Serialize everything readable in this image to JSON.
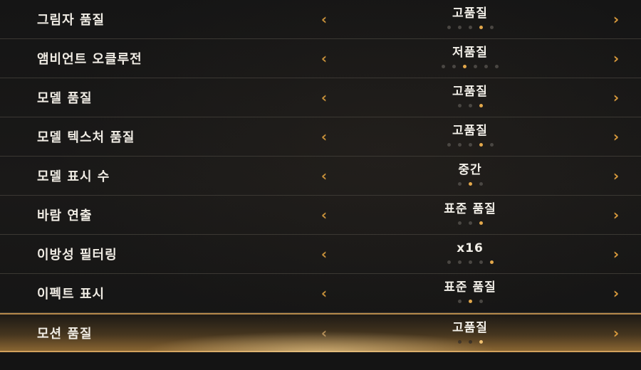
{
  "settings": [
    {
      "label": "그림자 품질",
      "value": "고품질",
      "levels": 5,
      "active": 3
    },
    {
      "label": "앰비언트 오클루전",
      "value": "저품질",
      "levels": 6,
      "active": 2
    },
    {
      "label": "모델 품질",
      "value": "고품질",
      "levels": 3,
      "active": 2
    },
    {
      "label": "모델 텍스처 품질",
      "value": "고품질",
      "levels": 5,
      "active": 3
    },
    {
      "label": "모델 표시 수",
      "value": "중간",
      "levels": 3,
      "active": 1
    },
    {
      "label": "바람 연출",
      "value": "표준 품질",
      "levels": 3,
      "active": 2
    },
    {
      "label": "이방성 필터링",
      "value": "x16",
      "levels": 5,
      "active": 4
    },
    {
      "label": "이펙트 표시",
      "value": "표준 품질",
      "levels": 3,
      "active": 1
    },
    {
      "label": "모션 품질",
      "value": "고품질",
      "levels": 3,
      "active": 2,
      "selected": true
    }
  ],
  "icons": {
    "left": "chevron-left-icon",
    "right": "chevron-right-icon"
  },
  "colors": {
    "accent": "#e3a84b",
    "text": "#f0ece4",
    "dot_inactive": "#4a4743",
    "divider": "#3b3833"
  }
}
